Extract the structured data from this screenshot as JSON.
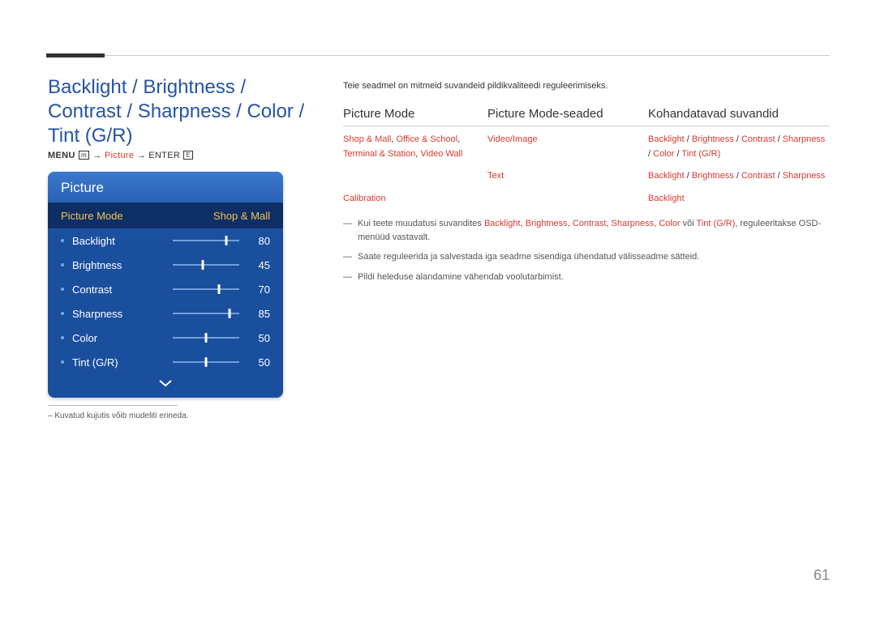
{
  "page_title": "Backlight / Brightness / Contrast / Sharpness / Color / Tint (G/R)",
  "menu_path": {
    "pre": "MENU ",
    "icon1": "m",
    "arrow1": " → ",
    "picture": "Picture",
    "arrow2": " → ENTER ",
    "icon2": "E"
  },
  "osd": {
    "title": "Picture",
    "mode_label": "Picture Mode",
    "mode_value": "Shop & Mall",
    "items": [
      {
        "label": "Backlight",
        "value": 80
      },
      {
        "label": "Brightness",
        "value": 45
      },
      {
        "label": "Contrast",
        "value": 70
      },
      {
        "label": "Sharpness",
        "value": 85
      },
      {
        "label": "Color",
        "value": 50
      },
      {
        "label": "Tint (G/R)",
        "value": 50
      }
    ]
  },
  "footnote": "– Kuvatud kujutis võib mudeliti erineda.",
  "intro": "Teie seadmel on mitmeid suvandeid pildikvaliteedi reguleerimiseks.",
  "headers": {
    "c1": "Picture Mode",
    "c2": "Picture Mode-seaded",
    "c3": "Kohandatavad suvandid"
  },
  "rows": {
    "r1c1a": "Shop & Mall",
    "r1c1b": ", ",
    "r1c1c": "Office & School",
    "r1c1d": ", ",
    "r1c1e": "Terminal & Station",
    "r1c1f": ", ",
    "r1c1g": "Video Wall",
    "r1c2": "Video/Image",
    "r1c3a": "Backlight",
    "r1c3b": " / ",
    "r1c3c": "Brightness",
    "r1c3d": " / ",
    "r1c3e": "Contrast",
    "r1c3f": " / ",
    "r1c3g": "Sharpness",
    "r1c3h": " / ",
    "r1c3i": "Color",
    "r1c3j": " / ",
    "r1c3k": "Tint (G/R)",
    "r2c2": "Text",
    "r2c3a": "Backlight",
    "r2c3b": " / ",
    "r2c3c": "Brightness",
    "r2c3d": " / ",
    "r2c3e": "Contrast",
    "r2c3f": " / ",
    "r2c3g": "Sharpness",
    "r3c1": "Calibration",
    "r3c3": "Backlight"
  },
  "notes": {
    "n1a": "Kui teete muudatusi suvandites ",
    "n1b": "Backlight",
    "n1c": ", ",
    "n1d": "Brightness",
    "n1e": ", ",
    "n1f": "Contrast",
    "n1g": ", ",
    "n1h": "Sharpness",
    "n1i": ", ",
    "n1j": "Color",
    "n1k": " või ",
    "n1l": "Tint (G/R)",
    "n1m": ", reguleeritakse OSD-menüüd vastavalt.",
    "n2": "Saate reguleerida ja salvestada iga seadme sisendiga ühendatud välisseadme sätteid.",
    "n3": "Pildi heleduse alandamine vähendab voolutarbimist."
  },
  "page_number": "61"
}
